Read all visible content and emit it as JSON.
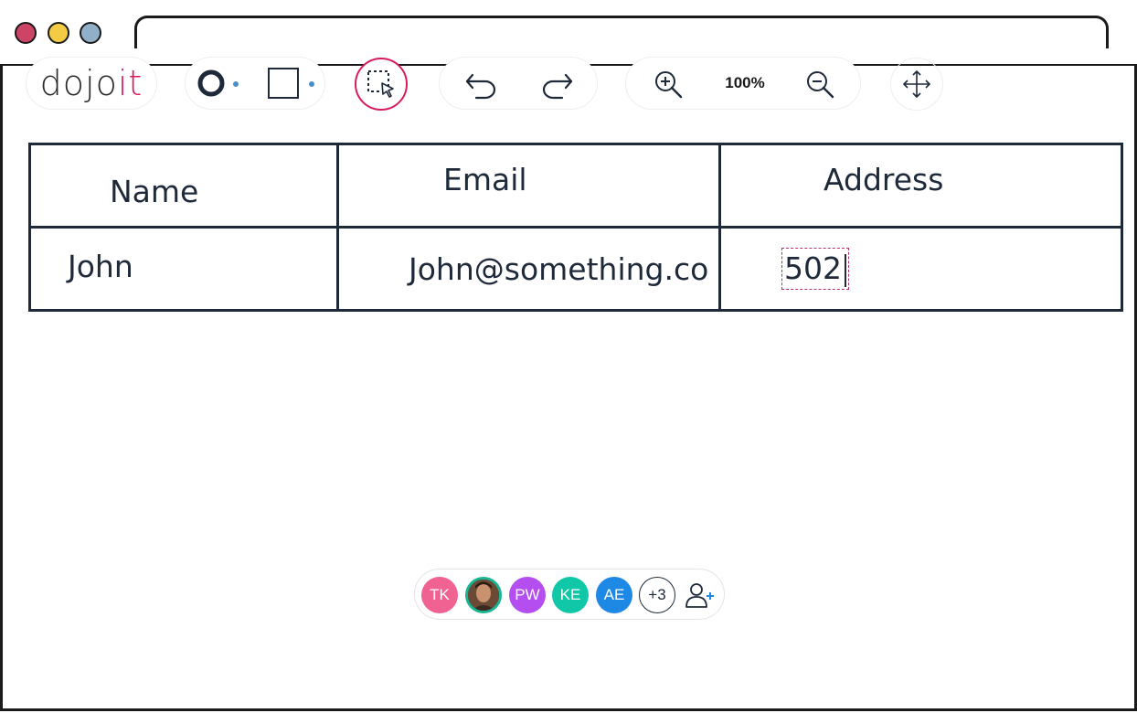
{
  "window": {
    "controls": [
      "close",
      "minimize",
      "maximize"
    ],
    "colors": {
      "close": "#cc4466",
      "minimize": "#f4cc44",
      "maximize": "#8fb0c8"
    }
  },
  "toolbar": {
    "logo": {
      "part1": "do",
      "part2": "jo",
      "part3": "it",
      "accent_color": "#d81b60"
    },
    "tools": {
      "circle_icon": "circle-shape-icon",
      "square_icon": "square-shape-icon",
      "select_icon": "marquee-select-icon",
      "undo_icon": "undo-icon",
      "redo_icon": "redo-icon",
      "zoom_in_icon": "zoom-in-icon",
      "zoom_out_icon": "zoom-out-icon",
      "move_icon": "move-icon"
    },
    "zoom_level": "100%"
  },
  "table": {
    "headers": [
      "Name",
      "Email",
      "Address"
    ],
    "rows": [
      {
        "name": "John",
        "email": "John@something.co",
        "address": "502"
      }
    ]
  },
  "collaborators": {
    "avatars": [
      {
        "initials": "TK",
        "color": "#f06292"
      },
      {
        "initials": "",
        "type": "photo",
        "ring_color": "#1ab394"
      },
      {
        "initials": "PW",
        "color": "#b44ef0"
      },
      {
        "initials": "KE",
        "color": "#10c8a8"
      },
      {
        "initials": "AE",
        "color": "#1e88e5"
      }
    ],
    "more_count": "+3",
    "add_icon": "add-user-icon"
  }
}
